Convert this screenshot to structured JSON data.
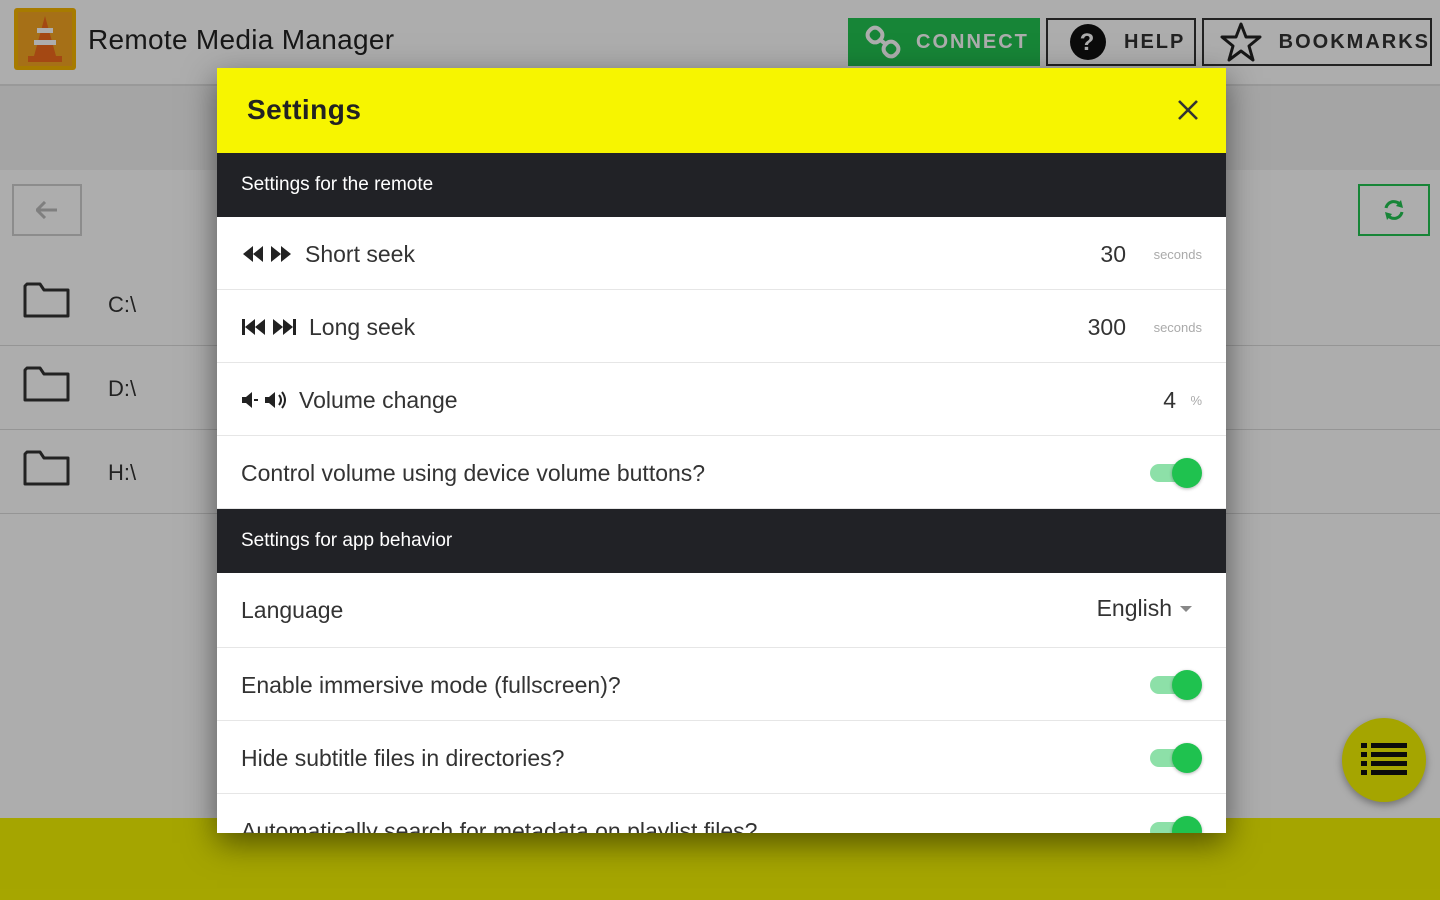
{
  "app": {
    "title": "Remote Media Manager",
    "connect_label": "CONNECT",
    "help_label": "HELP",
    "bookmarks_label": "BOOKMARKS"
  },
  "directories": [
    {
      "label": "C:\\"
    },
    {
      "label": "D:\\"
    },
    {
      "label": "H:\\"
    }
  ],
  "modal": {
    "title": "Settings",
    "sections": {
      "remote": {
        "heading": "Settings for the remote",
        "short_seek": {
          "label": "Short seek",
          "value": "30",
          "unit": "seconds"
        },
        "long_seek": {
          "label": "Long seek",
          "value": "300",
          "unit": "seconds"
        },
        "volume_change": {
          "label": "Volume change",
          "value": "4",
          "unit": "%"
        },
        "volume_buttons": {
          "label": "Control volume using device volume buttons?",
          "enabled": true
        }
      },
      "app": {
        "heading": "Settings for app behavior",
        "language": {
          "label": "Language",
          "value": "English"
        },
        "immersive": {
          "label": "Enable immersive mode (fullscreen)?",
          "enabled": true
        },
        "hide_subtitles": {
          "label": "Hide subtitle files in directories?",
          "enabled": true
        },
        "metadata": {
          "label": "Automatically search for metadata on playlist files?",
          "enabled": true
        }
      }
    }
  },
  "colors": {
    "accent_yellow": "#f7f500",
    "accent_green": "#22c552",
    "section_dark": "#212226"
  }
}
